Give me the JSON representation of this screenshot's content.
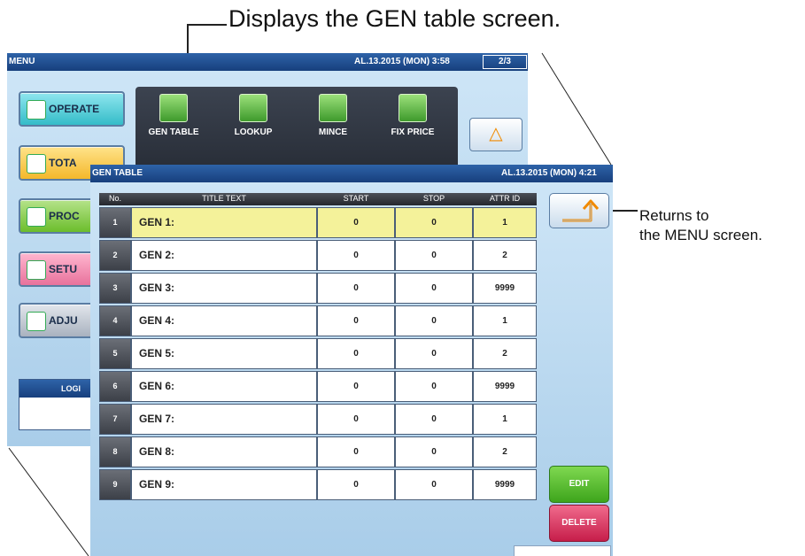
{
  "annotations": {
    "top": "Displays the GEN table screen.",
    "right_line1": "Returns to",
    "right_line2": "the MENU screen."
  },
  "menu_screen": {
    "title": "MENU",
    "datetime": "AL.13.2015 (MON)  3:58",
    "page": "2/3",
    "side_buttons": [
      "OPERATE",
      "TOTA",
      "PROC",
      "SETU",
      "ADJU"
    ],
    "login_label": "LOGI",
    "icons": [
      "GEN TABLE",
      "LOOKUP",
      "MINCE",
      "FIX PRICE"
    ],
    "up_button": "△"
  },
  "gen_screen": {
    "title": "GEN TABLE",
    "datetime": "AL.13.2015 (MON)  4:21",
    "columns": [
      "No.",
      "TITLE TEXT",
      "START",
      "STOP",
      "ATTR ID"
    ],
    "rows": [
      {
        "no": "1",
        "title": "GEN 1:",
        "start": "0",
        "stop": "0",
        "attr": "1"
      },
      {
        "no": "2",
        "title": "GEN 2:",
        "start": "0",
        "stop": "0",
        "attr": "2"
      },
      {
        "no": "3",
        "title": "GEN 3:",
        "start": "0",
        "stop": "0",
        "attr": "9999"
      },
      {
        "no": "4",
        "title": "GEN 4:",
        "start": "0",
        "stop": "0",
        "attr": "1"
      },
      {
        "no": "5",
        "title": "GEN 5:",
        "start": "0",
        "stop": "0",
        "attr": "2"
      },
      {
        "no": "6",
        "title": "GEN 6:",
        "start": "0",
        "stop": "0",
        "attr": "9999"
      },
      {
        "no": "7",
        "title": "GEN 7:",
        "start": "0",
        "stop": "0",
        "attr": "1"
      },
      {
        "no": "8",
        "title": "GEN 8:",
        "start": "0",
        "stop": "0",
        "attr": "2"
      },
      {
        "no": "9",
        "title": "GEN 9:",
        "start": "0",
        "stop": "0",
        "attr": "9999"
      }
    ],
    "edit_label": "EDIT",
    "delete_label": "DELETE"
  }
}
